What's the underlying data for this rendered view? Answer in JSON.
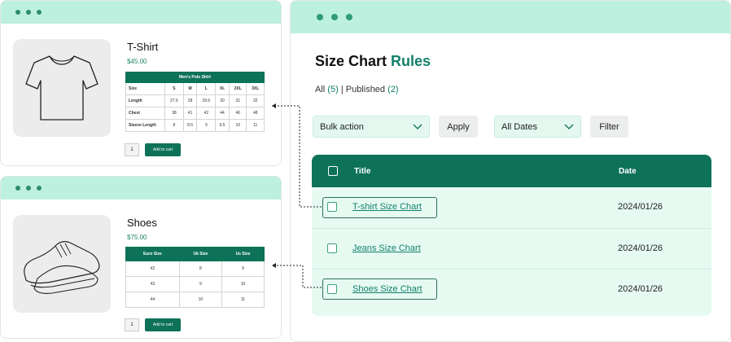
{
  "shirt_card": {
    "name": "T-Shirt",
    "price": "$45.00",
    "table_title": "Men's Polo Shirt",
    "headers": [
      "Size",
      "S",
      "M",
      "L",
      "XL",
      "2XL",
      "3XL"
    ],
    "rows": [
      [
        "Length",
        "27.5",
        "28",
        "29.5",
        "30",
        "31",
        "32"
      ],
      [
        "Chest",
        "38",
        "41",
        "42",
        "44",
        "46",
        "48"
      ],
      [
        "Sleeve Length",
        "8",
        "8.5",
        "9",
        "9.5",
        "10",
        "11"
      ]
    ],
    "qty": "1",
    "add_to_cart": "Add to cart"
  },
  "shoes_card": {
    "name": "Shoes",
    "price": "$75.00",
    "headers": [
      "Euro Size",
      "Uk Size",
      "Us Size"
    ],
    "rows": [
      [
        "42",
        "8",
        "9"
      ],
      [
        "43",
        "9",
        "10"
      ],
      [
        "44",
        "10",
        "11"
      ]
    ],
    "qty": "1",
    "add_to_cart": "Add to cart"
  },
  "admin": {
    "title_main": "Size Chart",
    "title_accent": "Rules",
    "filter_all": "All",
    "filter_all_count": "(5)",
    "filter_sep": "|",
    "filter_published": "Published",
    "filter_published_count": "(2)",
    "bulk_action": "Bulk action",
    "apply": "Apply",
    "all_dates": "All Dates",
    "filter": "Filter",
    "col_title": "Title",
    "col_date": "Date",
    "rows": [
      {
        "title": "T-shirt Size Chart",
        "date": "2024/01/26"
      },
      {
        "title": "Jeans Size Chart",
        "date": "2024/01/26"
      },
      {
        "title": "Shoes Size Chart",
        "date": "2024/01/26"
      }
    ]
  },
  "colors": {
    "accent": "#0d7258",
    "titlebar": "#bdf0de",
    "list_bg": "#e6faf2"
  }
}
